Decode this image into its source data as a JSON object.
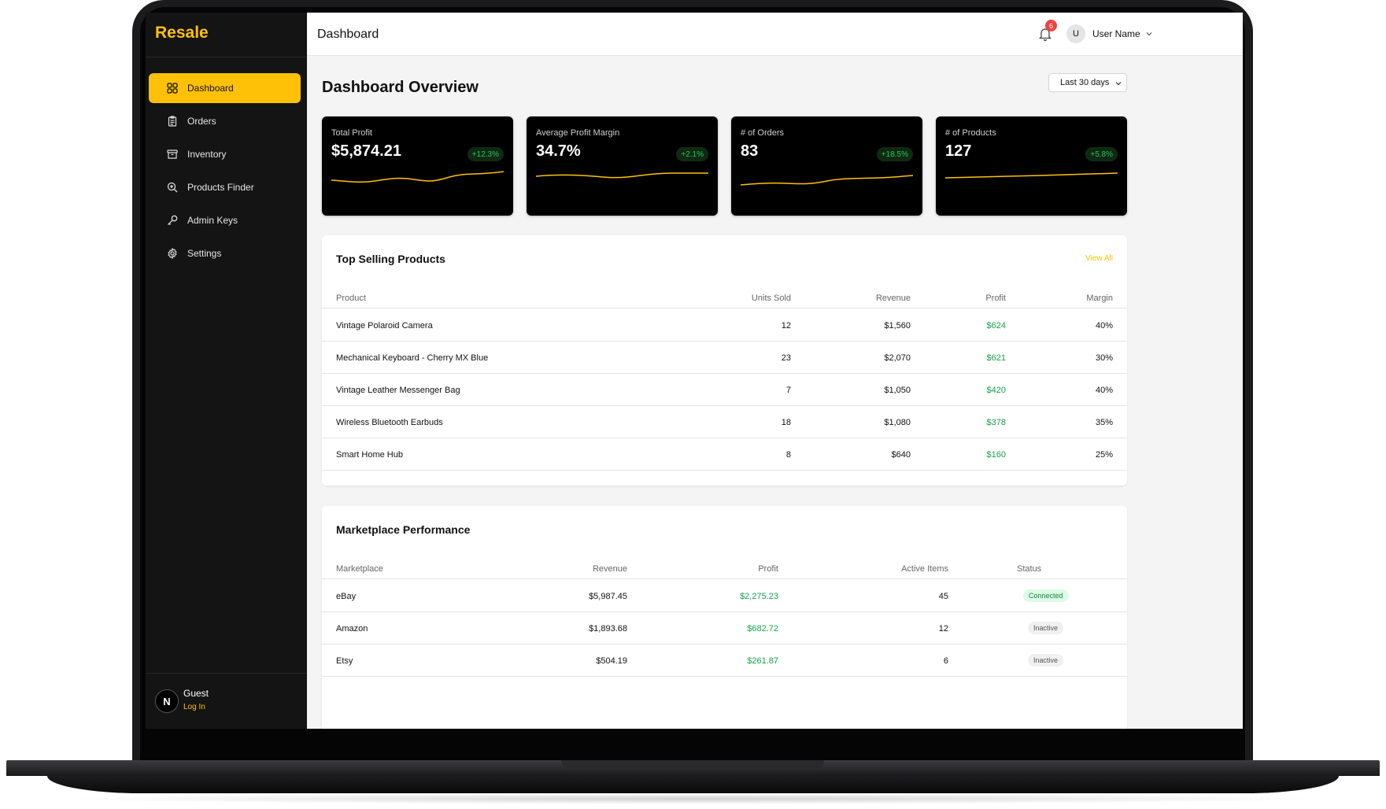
{
  "app": {
    "name": "Resale"
  },
  "sidebar": {
    "items": [
      {
        "label": "Dashboard",
        "icon": "grid-icon",
        "active": true
      },
      {
        "label": "Orders",
        "icon": "clipboard-icon",
        "active": false
      },
      {
        "label": "Inventory",
        "icon": "archive-icon",
        "active": false
      },
      {
        "label": "Products Finder",
        "icon": "search-icon",
        "active": false
      },
      {
        "label": "Admin Keys",
        "icon": "key-icon",
        "active": false
      },
      {
        "label": "Settings",
        "icon": "gear-icon",
        "active": false
      }
    ],
    "footer": {
      "avatar_letter": "N",
      "name": "Guest",
      "action": "Log In"
    }
  },
  "header": {
    "title": "Dashboard",
    "notifications_count": "6",
    "user": {
      "initial": "U",
      "name": "User Name"
    }
  },
  "overview": {
    "title": "Dashboard Overview",
    "range": "Last 30 days",
    "cards": [
      {
        "label": "Total Profit",
        "value": "$5,874.21",
        "change": "+12.3%"
      },
      {
        "label": "Average Profit Margin",
        "value": "34.7%",
        "change": "+2.1%"
      },
      {
        "label": "# of Orders",
        "value": "83",
        "change": "+18.5%"
      },
      {
        "label": "# of Products",
        "value": "127",
        "change": "+5.8%"
      }
    ]
  },
  "top_products": {
    "title": "Top Selling Products",
    "view_all": "View All",
    "columns": [
      "Product",
      "Units Sold",
      "Revenue",
      "Profit",
      "Margin"
    ],
    "rows": [
      [
        "Vintage Polaroid Camera",
        "12",
        "$1,560",
        "$624",
        "40%"
      ],
      [
        "Mechanical Keyboard - Cherry MX Blue",
        "23",
        "$2,070",
        "$621",
        "30%"
      ],
      [
        "Vintage Leather Messenger Bag",
        "7",
        "$1,050",
        "$420",
        "40%"
      ],
      [
        "Wireless Bluetooth Earbuds",
        "18",
        "$1,080",
        "$378",
        "35%"
      ],
      [
        "Smart Home Hub",
        "8",
        "$640",
        "$160",
        "25%"
      ]
    ]
  },
  "marketplaces": {
    "title": "Marketplace Performance",
    "columns": [
      "Marketplace",
      "Revenue",
      "Profit",
      "Active Items",
      "Status"
    ],
    "rows": [
      [
        "eBay",
        "$5,987.45",
        "$2,275.23",
        "45",
        "Connected"
      ],
      [
        "Amazon",
        "$1,893.68",
        "$682.72",
        "12",
        "Inactive"
      ],
      [
        "Etsy",
        "$504.19",
        "$261.87",
        "6",
        "Inactive"
      ]
    ]
  },
  "colors": {
    "accent": "#ffc107",
    "positive": "#16a34a",
    "sidebar": "#141414"
  }
}
